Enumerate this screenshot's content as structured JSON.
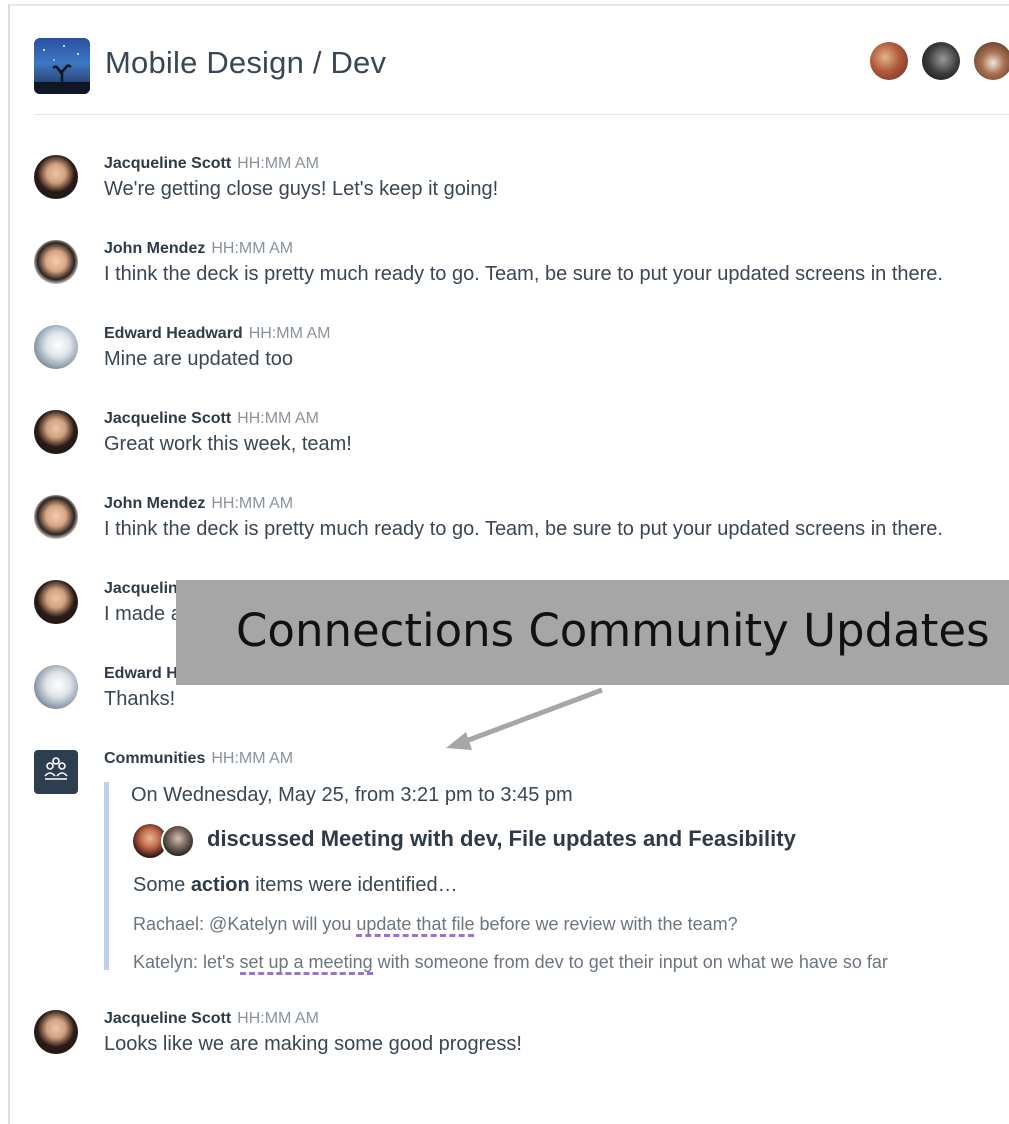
{
  "header": {
    "room_title": "Mobile Design / Dev",
    "room_logo_icon": "night-sky-tree-icon",
    "member_avatar_count": 3
  },
  "messages": [
    {
      "sender": "Jacqueline Scott",
      "time": "HH:MM AM",
      "text": "We're getting close guys! Let's keep it going!"
    },
    {
      "sender": "John Mendez",
      "time": "HH:MM AM",
      "text": "I think the deck is pretty much ready to go. Team, be sure to put your updated screens in there."
    },
    {
      "sender": "Edward Headward",
      "time": "HH:MM AM",
      "text": "Mine are updated too"
    },
    {
      "sender": "Jacqueline Scott",
      "time": "HH:MM AM",
      "text": "Great work this week, team!"
    },
    {
      "sender": "John Mendez",
      "time": "HH:MM AM",
      "text": "I think the deck is pretty much ready to go. Team, be sure to put your updated screens in there."
    },
    {
      "sender": "Jacquelin",
      "time": "",
      "text": "I made a"
    },
    {
      "sender": "Edward H",
      "time": "",
      "text": "Thanks!"
    }
  ],
  "community": {
    "sender": "Communities",
    "time": "HH:MM AM",
    "icon": "communities-icon",
    "date_range": "On Wednesday, May 25, from 3:21 pm to 3:45 pm",
    "topic": "discussed Meeting with dev, File updates and Feasibility",
    "action_prefix": "Some ",
    "action_bold": "action",
    "action_suffix": " items were identified…",
    "quote1": {
      "prefix": "Rachael: @Katelyn will you ",
      "highlight": "update that file",
      "suffix": " before we review with the team?"
    },
    "quote2": {
      "prefix": "Katelyn: let's ",
      "highlight": "set up a meeting",
      "suffix": " with someone from dev to get their input on what we have so far"
    }
  },
  "last_message": {
    "sender": "Jacqueline Scott",
    "time": "HH:MM AM",
    "text": "Looks like we are making some good progress!"
  },
  "overlay": {
    "label": "Connections Community Updates",
    "background": "#a6a6a6"
  },
  "colors": {
    "accent_border": "#bcd0ec",
    "highlight_underline": "#9b6fd6",
    "community_icon_bg": "#2d3e50"
  }
}
